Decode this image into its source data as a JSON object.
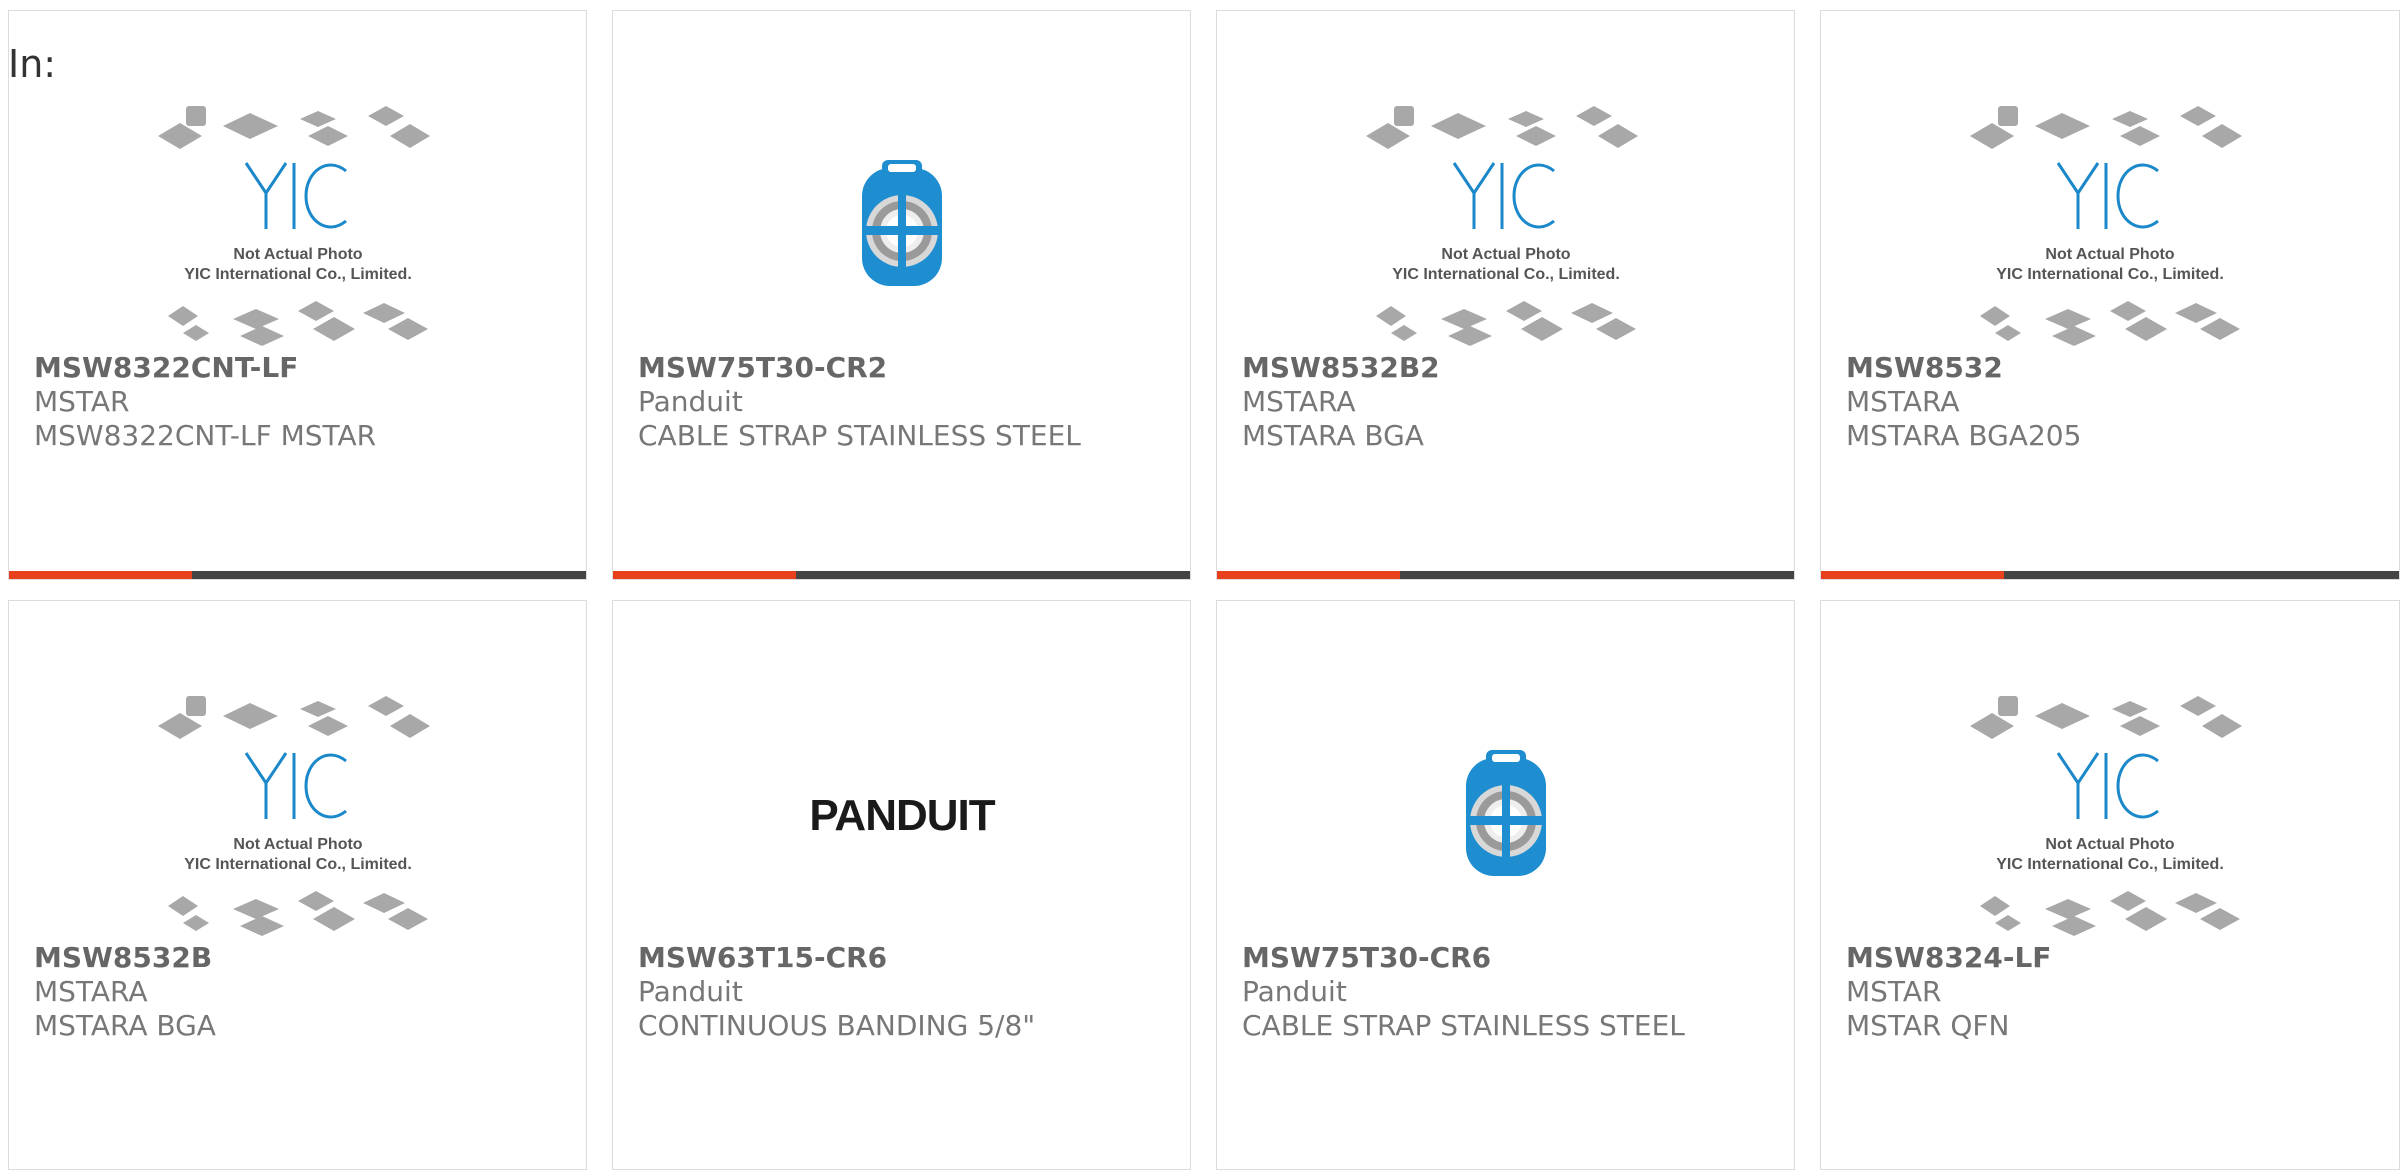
{
  "page": {
    "in_label": "In:"
  },
  "brand": {
    "accent_color": "#e8401c",
    "bar_color": "#444444",
    "yic_blue": "#1a88c9",
    "panduit_blue": "#1e8ed0"
  },
  "placeholder_text": {
    "logo": "YIC",
    "line1": "Not Actual Photo",
    "line2": "YIC International Co., Limited."
  },
  "panduit_logo_text": "PANDUIT",
  "products": [
    {
      "part_no": "MSW8322CNT-LF",
      "maker": "MSTAR",
      "desc": "MSW8322CNT-LF MSTAR",
      "image": "yic-placeholder"
    },
    {
      "part_no": "MSW75T30-CR2",
      "maker": "Panduit",
      "desc": "CABLE STRAP STAINLESS STEEL",
      "image": "cable-reel"
    },
    {
      "part_no": "MSW8532B2",
      "maker": "MSTARA",
      "desc": "MSTARA BGA",
      "image": "yic-placeholder"
    },
    {
      "part_no": "MSW8532",
      "maker": "MSTARA",
      "desc": "MSTARA BGA205",
      "image": "yic-placeholder"
    },
    {
      "part_no": "MSW8532B",
      "maker": "MSTARA",
      "desc": "MSTARA BGA",
      "image": "yic-placeholder"
    },
    {
      "part_no": "MSW63T15-CR6",
      "maker": "Panduit",
      "desc": "CONTINUOUS BANDING 5/8\"",
      "image": "panduit-logo"
    },
    {
      "part_no": "MSW75T30-CR6",
      "maker": "Panduit",
      "desc": "CABLE STRAP STAINLESS STEEL",
      "image": "cable-reel"
    },
    {
      "part_no": "MSW8324-LF",
      "maker": "MSTAR",
      "desc": "MSTAR QFN",
      "image": "yic-placeholder"
    }
  ]
}
